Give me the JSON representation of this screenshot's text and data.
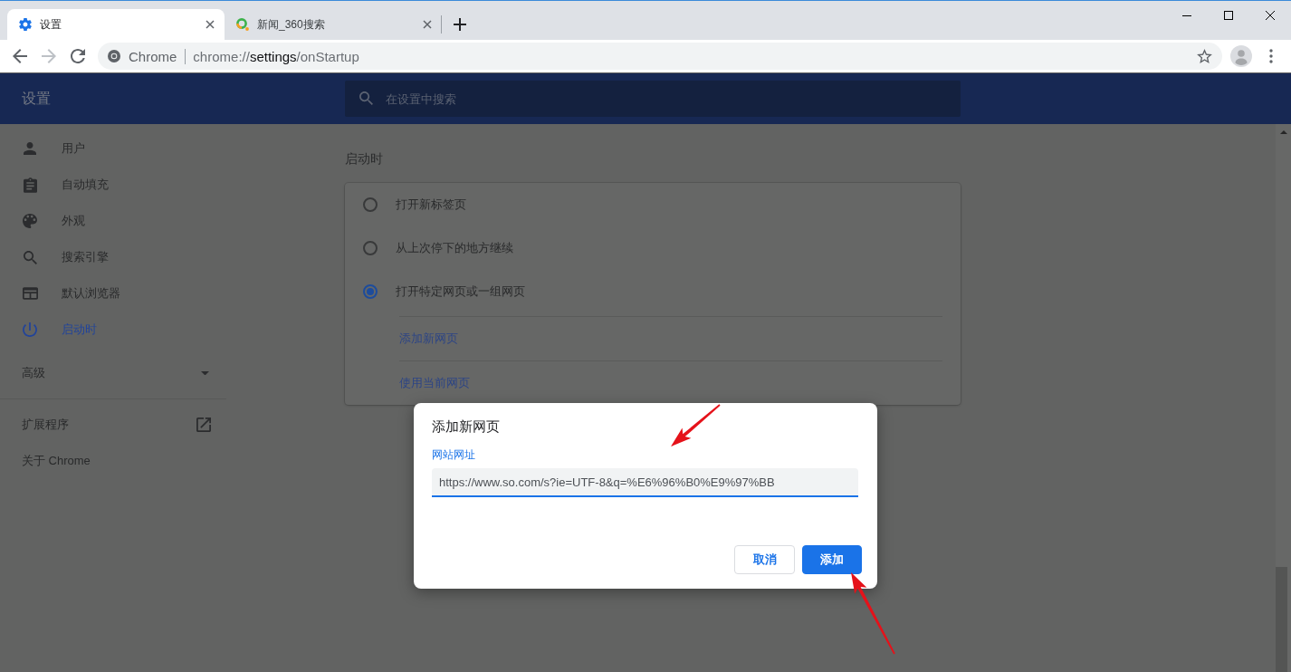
{
  "tabs": [
    {
      "title": "设置",
      "selected": true
    },
    {
      "title": "新闻_360搜索",
      "selected": false
    }
  ],
  "toolbar": {
    "navigation": [
      {
        "kind": "back",
        "disabled": false
      },
      {
        "kind": "forward",
        "disabled": true
      },
      {
        "kind": "reload",
        "disabled": false
      }
    ],
    "origin_label": "Chrome",
    "url": "chrome://**settings**/onStartup",
    "bookmarked": false
  },
  "settings_header": {
    "title": "设置",
    "search_placeholder": "在设置中搜索"
  },
  "sidebar": {
    "items": [
      {
        "label": "用户",
        "selected": false
      },
      {
        "label": "自动填充",
        "selected": false
      },
      {
        "label": "外观",
        "selected": false
      },
      {
        "label": "搜索引擎",
        "selected": false
      },
      {
        "label": "默认浏览器",
        "selected": false
      },
      {
        "label": "启动时",
        "selected": true
      }
    ],
    "advanced": {
      "label": "高级",
      "expanded": false
    },
    "links": [
      {
        "label": "扩展程序",
        "kind": "external"
      },
      {
        "label": "关于 Chrome",
        "kind": "internal"
      }
    ]
  },
  "startup": {
    "title": "启动时",
    "options": [
      {
        "label": "打开新标签页",
        "selected": false
      },
      {
        "label": "从上次停下的地方继续",
        "selected": false
      },
      {
        "label": "打开特定网页或一组网页",
        "selected": true
      }
    ],
    "actions": [
      "添加新网页",
      "使用当前网页"
    ]
  },
  "dialog": {
    "title": "添加新网页",
    "field": {
      "label": "网站网址",
      "value": "https://www.so.com/s?ie=UTF-8&q=%E6%96%B0%E9%97%BB",
      "focused": true
    },
    "buttons": [
      {
        "label": "取消",
        "kind": "secondary"
      },
      {
        "label": "添加",
        "kind": "primary"
      }
    ]
  }
}
